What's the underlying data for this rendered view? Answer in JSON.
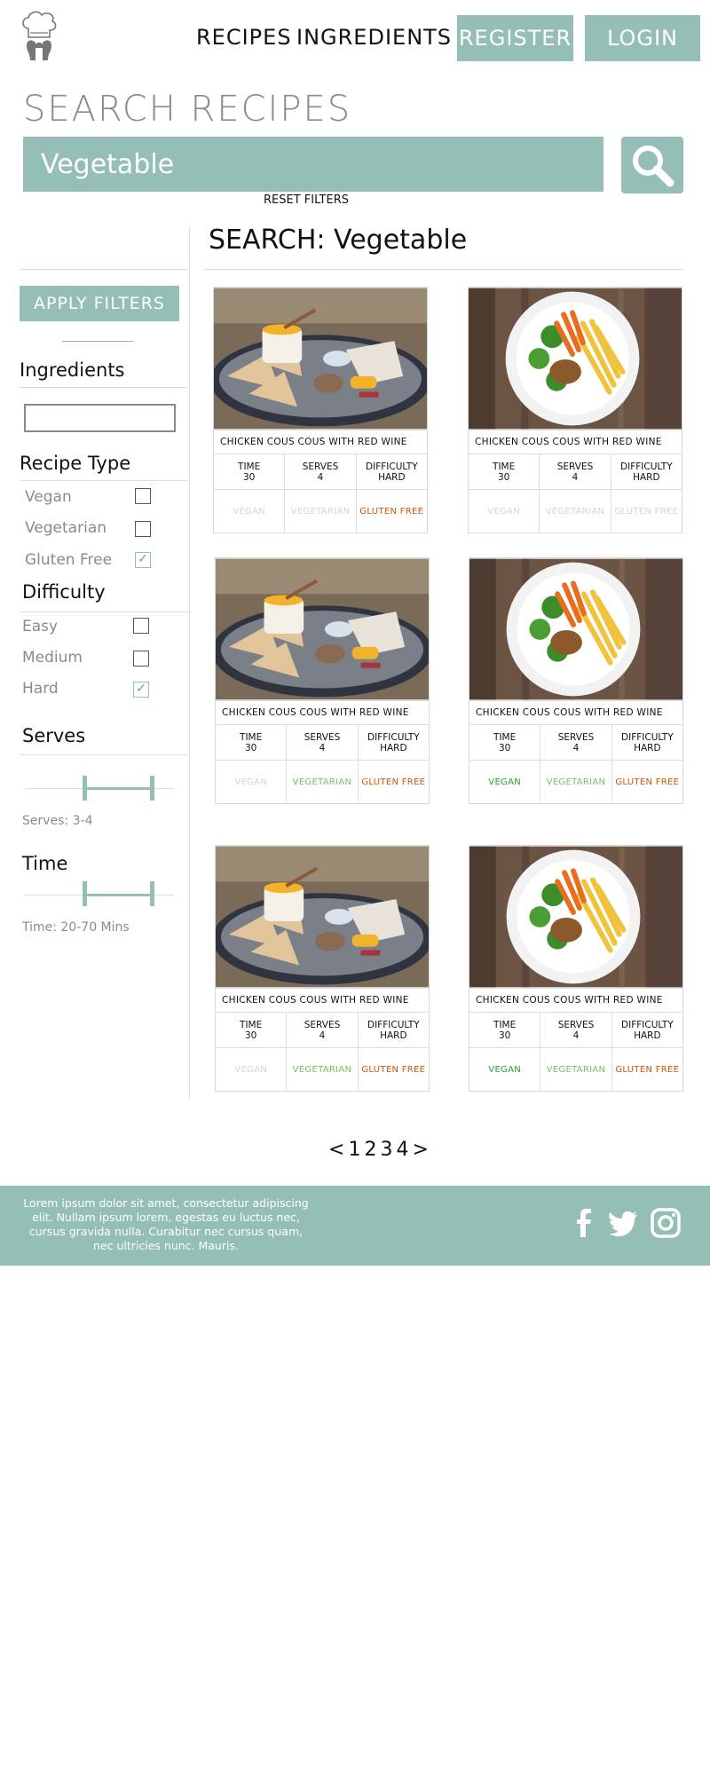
{
  "nav": {
    "recipes": "RECIPES",
    "ingredients": "INGREDIENTS",
    "register": "REGISTER",
    "login": "LOGIN"
  },
  "search": {
    "title": "SEARCH RECIPES",
    "value": "Vegetable",
    "reset": "RESET FILTERS",
    "search_icon": "magnifier-icon"
  },
  "sidebar": {
    "apply": "APPLY FILTERS",
    "ingredients_title": "Ingredients",
    "ingredients_value": "",
    "recipe_type_title": "Recipe Type",
    "recipe_types": [
      {
        "label": "Vegan",
        "checked": false
      },
      {
        "label": "Vegetarian",
        "checked": false
      },
      {
        "label": "Gluten Free",
        "checked": true
      }
    ],
    "difficulty_title": "Difficulty",
    "difficulties": [
      {
        "label": "Easy",
        "checked": false
      },
      {
        "label": "Medium",
        "checked": false
      },
      {
        "label": "Hard",
        "checked": true
      }
    ],
    "serves_title": "Serves",
    "serves_caption": "Serves: 3-4",
    "time_title": "Time",
    "time_caption": "Time: 20-70 Mins"
  },
  "results": {
    "title": "SEARCH: Vegetable",
    "cards": [
      {
        "name": "CHICKEN COUS COUS WITH RED WINE",
        "image": "platter",
        "time_label": "TIME",
        "time": "30",
        "serves_label": "SERVES",
        "serves": "4",
        "difficulty_label": "DIFFICULTY",
        "difficulty": "HARD",
        "tags": [
          {
            "label": "VEGAN",
            "active": false
          },
          {
            "label": "VEGETARIAN",
            "active": false
          },
          {
            "label": "GLUTEN FREE",
            "active": true
          }
        ]
      },
      {
        "name": "CHICKEN COUS COUS WITH RED WINE",
        "image": "plate",
        "time_label": "TIME",
        "time": "30",
        "serves_label": "SERVES",
        "serves": "4",
        "difficulty_label": "DIFFICULTY",
        "difficulty": "HARD",
        "tags": [
          {
            "label": "VEGAN",
            "active": false
          },
          {
            "label": "VEGETARIAN",
            "active": false
          },
          {
            "label": "GLUTEN FREE",
            "active": false
          }
        ]
      },
      {
        "name": "CHICKEN COUS COUS WITH RED WINE",
        "image": "platter",
        "time_label": "TIME",
        "time": "30",
        "serves_label": "SERVES",
        "serves": "4",
        "difficulty_label": "DIFFICULTY",
        "difficulty": "HARD",
        "tags": [
          {
            "label": "VEGAN",
            "active": false
          },
          {
            "label": "VEGETARIAN",
            "active": true
          },
          {
            "label": "GLUTEN FREE",
            "active": true
          }
        ]
      },
      {
        "name": "CHICKEN COUS COUS WITH RED WINE",
        "image": "plate",
        "time_label": "TIME",
        "time": "30",
        "serves_label": "SERVES",
        "serves": "4",
        "difficulty_label": "DIFFICULTY",
        "difficulty": "HARD",
        "tags": [
          {
            "label": "VEGAN",
            "active": true
          },
          {
            "label": "VEGETARIAN",
            "active": true
          },
          {
            "label": "GLUTEN FREE",
            "active": true
          }
        ]
      },
      {
        "name": "CHICKEN COUS COUS WITH RED WINE",
        "image": "platter",
        "time_label": "TIME",
        "time": "30",
        "serves_label": "SERVES",
        "serves": "4",
        "difficulty_label": "DIFFICULTY",
        "difficulty": "HARD",
        "tags": [
          {
            "label": "VEGAN",
            "active": false
          },
          {
            "label": "VEGETARIAN",
            "active": true
          },
          {
            "label": "GLUTEN FREE",
            "active": true
          }
        ]
      },
      {
        "name": "CHICKEN COUS COUS WITH RED WINE",
        "image": "plate",
        "time_label": "TIME",
        "time": "30",
        "serves_label": "SERVES",
        "serves": "4",
        "difficulty_label": "DIFFICULTY",
        "difficulty": "HARD",
        "tags": [
          {
            "label": "VEGAN",
            "active": true
          },
          {
            "label": "VEGETARIAN",
            "active": true
          },
          {
            "label": "GLUTEN FREE",
            "active": true
          }
        ]
      }
    ]
  },
  "pagination": {
    "prev": "<",
    "pages": [
      "1",
      "2",
      "3",
      "4"
    ],
    "next": ">"
  },
  "footer": {
    "text": "Lorem ipsum dolor sit amet, consectetur adipiscing elit. Nullam ipsum lorem, egestas eu luctus nec, cursus gravida nulla. Curabitur nec cursus quam, nec ultricies nunc. Mauris.",
    "social": [
      "facebook-icon",
      "twitter-icon",
      "instagram-icon"
    ]
  },
  "colors": {
    "accent": "#95bfb6",
    "muted_text": "#8a8a8a",
    "vegan_active": "#2aa035",
    "vegetarian_active": "#6fc55b",
    "gluten_free_active": "#d35400",
    "tag_inactive": "#d4d4d4"
  }
}
